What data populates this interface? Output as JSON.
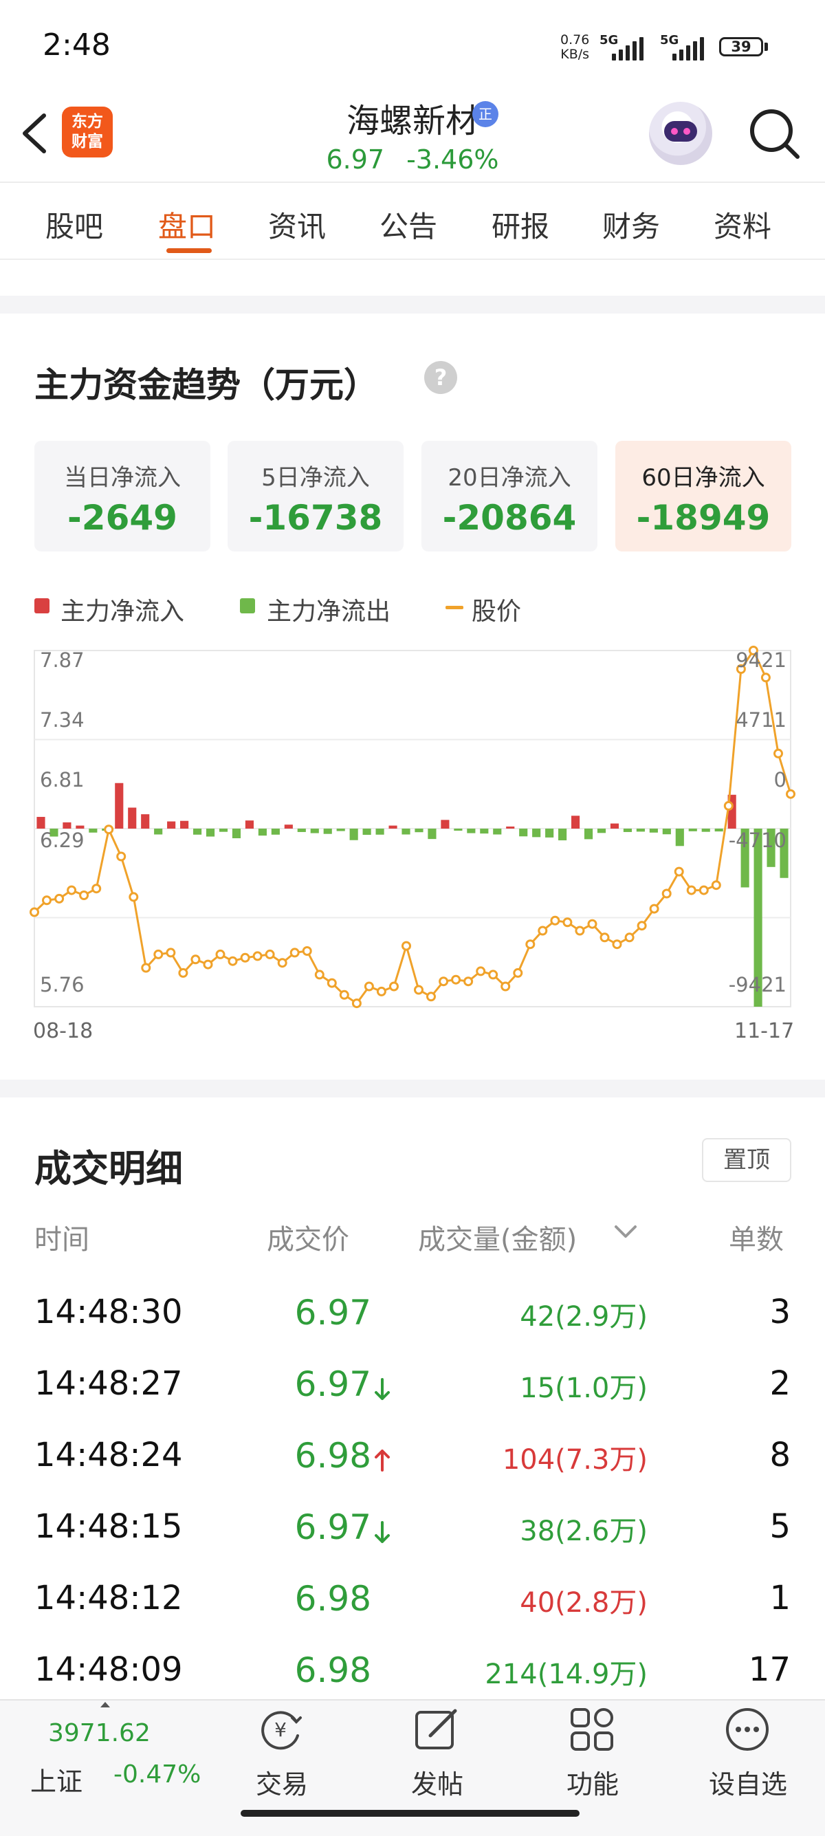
{
  "status_bar": {
    "time": "2:48",
    "net_speed_value": "0.76",
    "net_speed_unit": "KB/s",
    "signal1_label": "5G",
    "signal2_label": "5G",
    "battery": "39"
  },
  "header": {
    "logo_line1": "东方",
    "logo_line2": "财富",
    "stock_name": "海螺新材",
    "badge": "正",
    "price": "6.97",
    "change_pct": "-3.46%"
  },
  "tabs": [
    {
      "label": "股吧",
      "active": false
    },
    {
      "label": "盘口",
      "active": true
    },
    {
      "label": "资讯",
      "active": false
    },
    {
      "label": "公告",
      "active": false
    },
    {
      "label": "研报",
      "active": false
    },
    {
      "label": "财务",
      "active": false
    },
    {
      "label": "资料",
      "active": false
    }
  ],
  "fund_section": {
    "title": "主力资金趋势（万元）",
    "help": "?",
    "cards": [
      {
        "label": "当日净流入",
        "value": "-2649",
        "highlighted": false
      },
      {
        "label": "5日净流入",
        "value": "-16738",
        "highlighted": false
      },
      {
        "label": "20日净流入",
        "value": "-20864",
        "highlighted": false
      },
      {
        "label": "60日净流入",
        "value": "-18949",
        "highlighted": true
      }
    ],
    "legend": {
      "inflow": "主力净流入",
      "outflow": "主力净流出",
      "price": "股价"
    }
  },
  "colors": {
    "accent": "#e15a19",
    "up": "#d83a3a",
    "down": "#2f9d3a",
    "price_line": "#f0a22a",
    "inflow_bar": "#d94040",
    "outflow_bar": "#6fb84a"
  },
  "chart_data": {
    "type": "bar+line",
    "x_start": "08-18",
    "x_end": "11-17",
    "left_axis_ticks": [
      "7.87",
      "7.34",
      "6.81",
      "6.29",
      "5.76"
    ],
    "right_axis_ticks": [
      "9421",
      "4711",
      "0",
      "-4710",
      "-9421"
    ],
    "price_range": [
      5.76,
      7.87
    ],
    "flow_range": [
      -9421,
      9421
    ],
    "grid": true,
    "price_series": {
      "name": "股价",
      "values": [
        6.32,
        6.39,
        6.4,
        6.45,
        6.42,
        6.46,
        6.81,
        6.65,
        6.41,
        5.99,
        6.07,
        6.08,
        5.96,
        6.04,
        6.01,
        6.07,
        6.03,
        6.05,
        6.06,
        6.07,
        6.02,
        6.08,
        6.09,
        5.95,
        5.9,
        5.83,
        5.78,
        5.88,
        5.85,
        5.88,
        6.12,
        5.86,
        5.82,
        5.91,
        5.92,
        5.91,
        5.97,
        5.95,
        5.88,
        5.96,
        6.13,
        6.21,
        6.27,
        6.26,
        6.21,
        6.25,
        6.17,
        6.13,
        6.17,
        6.24,
        6.34,
        6.43,
        6.56,
        6.45,
        6.45,
        6.48,
        6.95,
        7.76,
        7.87,
        7.71,
        7.26,
        7.02
      ]
    },
    "flow_series": {
      "name": "主力净流入/净流出",
      "values": [
        620,
        -420,
        330,
        160,
        -210,
        -110,
        2410,
        1110,
        760,
        -310,
        380,
        410,
        -320,
        -420,
        -170,
        -510,
        430,
        -370,
        -320,
        210,
        -180,
        -240,
        -280,
        -130,
        -610,
        -330,
        -320,
        160,
        -310,
        -190,
        -550,
        460,
        -110,
        -240,
        -260,
        -310,
        110,
        -410,
        -450,
        -470,
        -620,
        680,
        -560,
        -230,
        270,
        -180,
        -160,
        -210,
        -300,
        -920,
        -140,
        -170,
        -150,
        1790,
        -3110,
        -9421,
        -2030,
        -2610
      ]
    }
  },
  "deals": {
    "title": "成交明细",
    "pin_label": "置顶",
    "headers": {
      "time": "时间",
      "price": "成交价",
      "volume": "成交量(金额)",
      "count": "单数"
    },
    "rows": [
      {
        "time": "14:48:30",
        "price": "6.97",
        "arrow": "",
        "volume": "42(2.9万)",
        "volume_dir": "down",
        "count": "3"
      },
      {
        "time": "14:48:27",
        "price": "6.97",
        "arrow": "down",
        "volume": "15(1.0万)",
        "volume_dir": "down",
        "count": "2"
      },
      {
        "time": "14:48:24",
        "price": "6.98",
        "arrow": "up",
        "volume": "104(7.3万)",
        "volume_dir": "up",
        "count": "8"
      },
      {
        "time": "14:48:15",
        "price": "6.97",
        "arrow": "down",
        "volume": "38(2.6万)",
        "volume_dir": "down",
        "count": "5"
      },
      {
        "time": "14:48:12",
        "price": "6.98",
        "arrow": "",
        "volume": "40(2.8万)",
        "volume_dir": "up",
        "count": "1"
      },
      {
        "time": "14:48:09",
        "price": "6.98",
        "arrow": "",
        "volume": "214(14.9万)",
        "volume_dir": "down",
        "count": "17"
      }
    ]
  },
  "bottom_bar": {
    "index_value": "3971.62",
    "index_name": "上证",
    "index_change": "-0.47%",
    "nav": [
      {
        "label": "交易",
        "icon": "trade-yen-icon"
      },
      {
        "label": "发帖",
        "icon": "edit-post-icon"
      },
      {
        "label": "功能",
        "icon": "grid-apps-icon"
      },
      {
        "label": "设自选",
        "icon": "more-dots-icon"
      }
    ]
  }
}
